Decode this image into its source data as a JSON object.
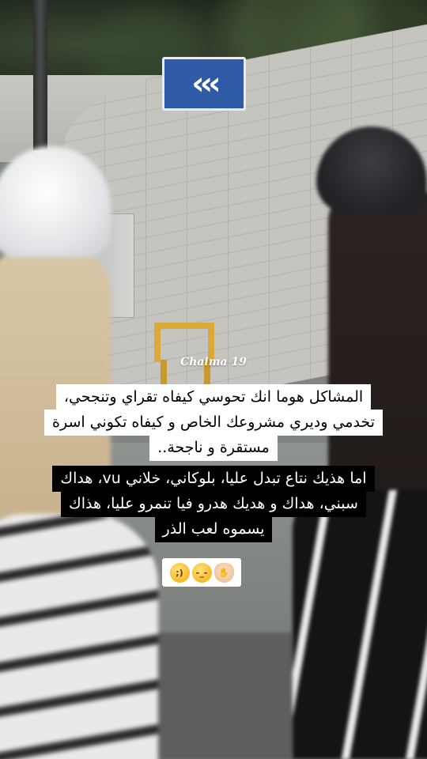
{
  "scene": {
    "background": "street-photo",
    "sign_glyph": "‹‹‹"
  },
  "watermark": "Chaima 19",
  "caption_white": [
    "المشاكل هوما انك تحوسي كيفاه تقراي وتنجحي،",
    "تخدمي وديري مشروعك الخاص و كيفاه تكوني اسرة",
    "مستقرة و ناجحة.."
  ],
  "caption_black": [
    "اما هذيك نتاع تبدل عليا، بلوكاني، خلاني vu، هداك",
    "سبني، هداك و هديك هدرو فيا تنمرو عليا، هذاك",
    "يسموه لعب الذر"
  ],
  "emojis": [
    {
      "name": "winking-face-icon",
      "glyph": ";)"
    },
    {
      "name": "unamused-face-icon",
      "glyph": "-_-"
    },
    {
      "name": "pinched-fingers-icon",
      "glyph": "✋"
    }
  ],
  "colors": {
    "caption_white_bg": "#ffffff",
    "caption_black_bg": "#000000",
    "sign_blue": "#2f5aa6"
  }
}
